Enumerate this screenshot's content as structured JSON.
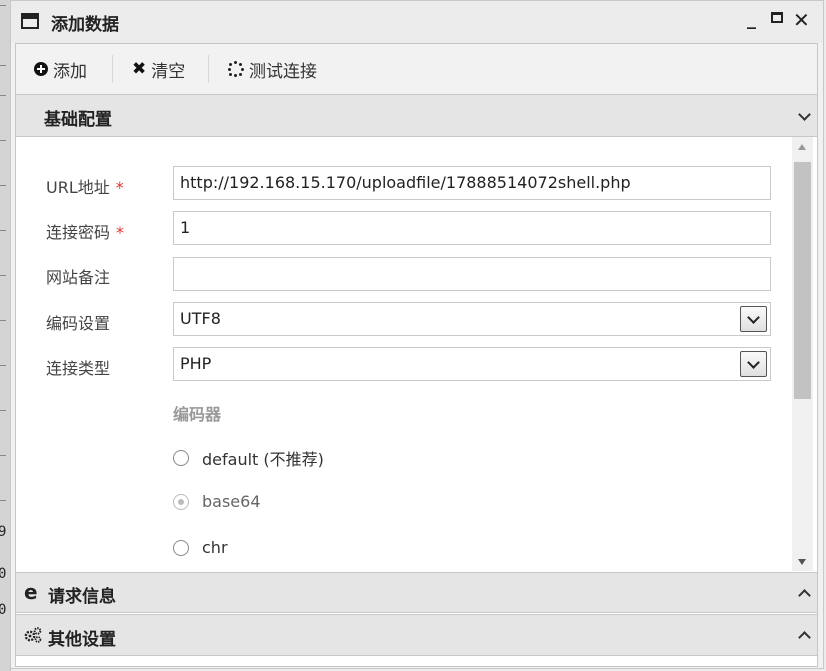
{
  "window": {
    "title": "添加数据",
    "controls": {
      "minimize": "_",
      "close": "✕"
    }
  },
  "background_numbers": [
    "9",
    "0",
    "0"
  ],
  "toolbar": {
    "add_label": "添加",
    "clear_label": "清空",
    "test_label": "测试连接"
  },
  "sections": {
    "basic": "基础配置",
    "request": "请求信息",
    "other": "其他设置"
  },
  "form": {
    "url": {
      "label": "URL地址",
      "required": "*",
      "value": "http://192.168.15.170/uploadfile/17888514072shell.php"
    },
    "password": {
      "label": "连接密码",
      "required": "*",
      "value": "1"
    },
    "note": {
      "label": "网站备注",
      "value": ""
    },
    "encoding": {
      "label": "编码设置",
      "value": "UTF8"
    },
    "type": {
      "label": "连接类型",
      "value": "PHP"
    },
    "encoder": {
      "title": "编码器",
      "options": [
        {
          "label": "default (不推荐)",
          "checked": false
        },
        {
          "label": "base64",
          "checked": true
        },
        {
          "label": "chr",
          "checked": false
        }
      ]
    }
  },
  "scrollbar": {
    "position_fraction": 0.0,
    "visible_fraction": 0.55
  },
  "icons": {
    "window": "window-icon",
    "add": "plus-circle-icon",
    "clear": "x-icon",
    "test": "spinner-icon",
    "basic": "file-text-icon",
    "request": "edge-icon",
    "other": "gears-icon"
  }
}
